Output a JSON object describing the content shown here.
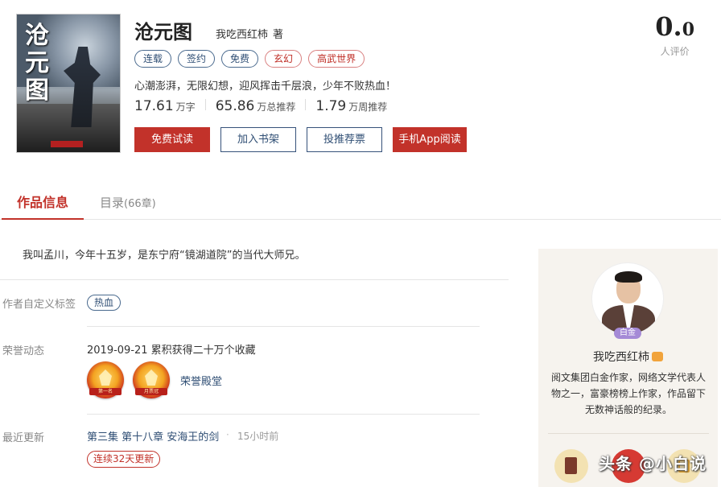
{
  "book": {
    "cover_title": "沧元图",
    "title": "沧元图",
    "author": "我吃西红柿",
    "author_suffix": "著",
    "tags": [
      {
        "label": "连载",
        "style": "blue"
      },
      {
        "label": "签约",
        "style": "blue"
      },
      {
        "label": "免费",
        "style": "blue"
      },
      {
        "label": "玄幻",
        "style": "red"
      },
      {
        "label": "高武世界",
        "style": "red"
      }
    ],
    "intro": "心潮澎湃，无限幻想，迎风挥击千层浪，少年不败热血！",
    "stats": [
      {
        "value": "17.61",
        "unit": "万字"
      },
      {
        "value": "65.86",
        "unit": "万总推荐"
      },
      {
        "value": "1.79",
        "unit": "万周推荐"
      }
    ],
    "buttons": {
      "free_read": "免费试读",
      "add_shelf": "加入书架",
      "vote": "投推荐票",
      "app_read": "手机App阅读"
    },
    "rating": {
      "main": "0.",
      "decimal": "0",
      "label": "人评价"
    }
  },
  "tabs": {
    "info": "作品信息",
    "catalog": "目录",
    "catalog_count": "(66章)"
  },
  "info": {
    "summary": "我叫孟川，今年十五岁，是东宁府“镜湖道院”的当代大师兄。",
    "custom_tags_label": "作者自定义标签",
    "custom_tag": "热血",
    "honor_label": "荣誉动态",
    "honor_text": "2019-09-21 累积获得二十万个收藏",
    "badges": [
      "第一名",
      "月票冠"
    ],
    "hall_link": "荣誉殿堂",
    "latest_label": "最近更新",
    "latest_chapter": "第三集 第十八章 安海王的剑",
    "latest_dot": "·",
    "latest_time": "15小时前",
    "streak": "连续32天更新"
  },
  "author_panel": {
    "level": "白金",
    "name": "我吃西红柿",
    "description": "阅文集团白金作家，网络文学代表人物之一，富豪榜榜上作家，作品留下无数神话般的纪录。"
  },
  "watermark": "头条 @小白说",
  "colors": {
    "accent_red": "#c2322a",
    "link_blue": "#2f4e74",
    "panel_bg": "#f6f3ee",
    "level_purple": "#a58ad6"
  }
}
